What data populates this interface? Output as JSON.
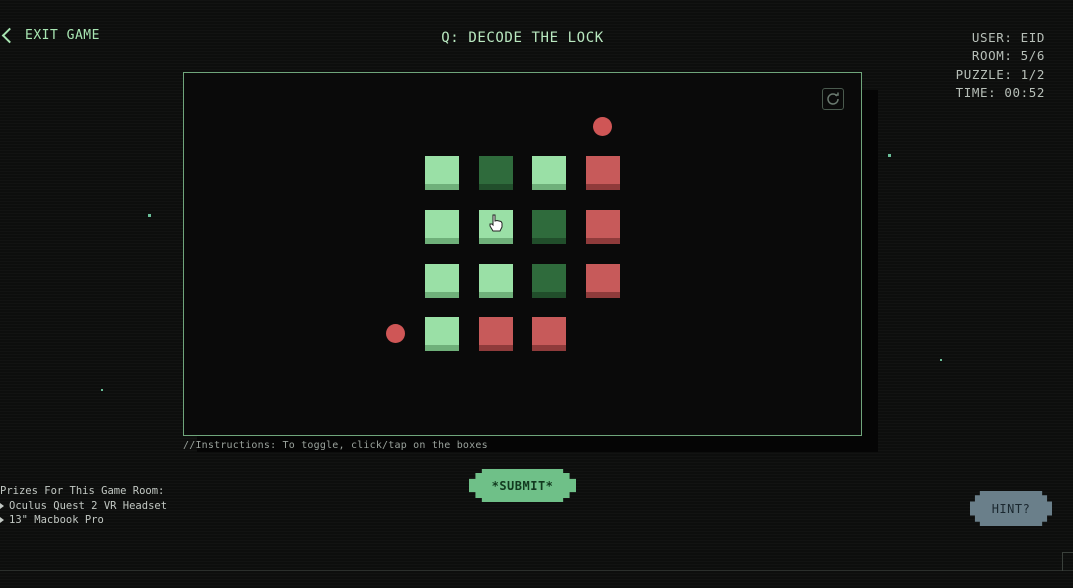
{
  "header": {
    "exit_label": "EXIT GAME",
    "title": "Q: DECODE THE LOCK"
  },
  "stats": {
    "user": "USER: EID",
    "room": "ROOM: 5/6",
    "puzzle": "PUZZLE: 1/2",
    "time": "TIME: 00:52"
  },
  "puzzle": {
    "grid": [
      [
        "light",
        "dark",
        "light",
        "red"
      ],
      [
        "light",
        "light",
        "dark",
        "red"
      ],
      [
        "light",
        "light",
        "dark",
        "red"
      ],
      [
        "light",
        "red",
        "red"
      ]
    ],
    "colors": {
      "light": "#9ae0a6",
      "dark": "#2f6b3c",
      "red": "#c75a5a",
      "border": "#6fa57b"
    }
  },
  "instructions": "//Instructions: To toggle, click/tap on the boxes",
  "buttons": {
    "submit": "*SUBMIT*",
    "hint": "HINT?"
  },
  "prizes": {
    "heading": "Prizes For This Game Room:",
    "items": [
      "Oculus Quest 2 VR Headset",
      "13\" Macbook Pro"
    ]
  },
  "icons": {
    "reset": "refresh-icon",
    "exit": "chevron-left-icon"
  }
}
